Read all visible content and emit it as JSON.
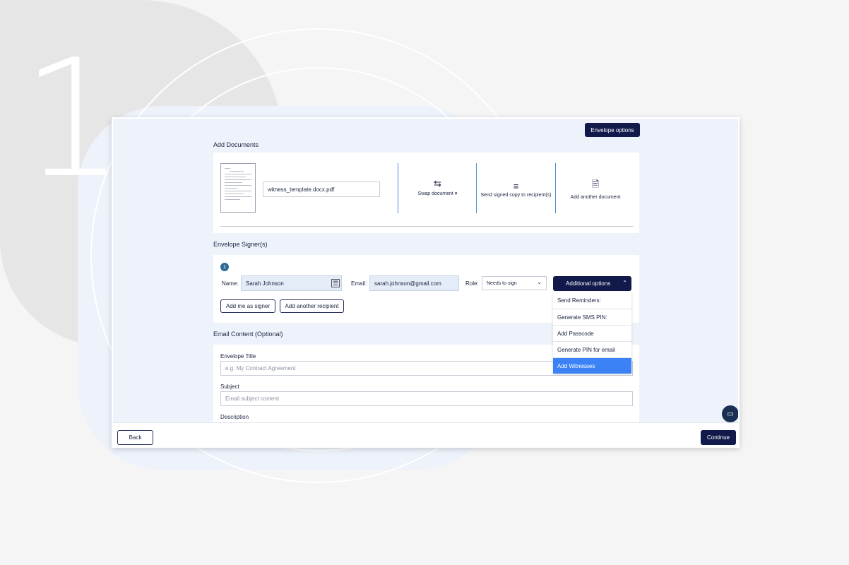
{
  "step_number": "1",
  "header": {
    "envelope_options_label": "Envelope options"
  },
  "documents": {
    "section_title": "Add Documents",
    "filename": "witness_template.docx.pdf",
    "actions": [
      {
        "label": "Swap document ▾",
        "icon": "swap-arrows-icon"
      },
      {
        "label": "Send signed copy to recipient(s)",
        "icon": "text-lines-icon"
      },
      {
        "label": "Add another document",
        "icon": "add-document-icon"
      }
    ]
  },
  "signers": {
    "section_title": "Envelope Signer(s)",
    "signer_number": "1",
    "name_label": "Name:",
    "name_value": "Sarah Johnson",
    "email_label": "Email:",
    "email_value": "sarah.johnson@gmail.com",
    "role_label": "Role:",
    "role_value": "Needs to sign",
    "additional_options_label": "Additional options",
    "add_me_label": "Add me as signer",
    "add_recipient_label": "Add another recipient",
    "options_menu": [
      "Send Reminders:",
      "Generate SMS PIN:",
      "Add Passcode",
      "Generate PIN for email",
      "Add Witnesses"
    ]
  },
  "email_content": {
    "section_title": "Email Content (Optional)",
    "envelope_title_label": "Envelope Title",
    "envelope_title_placeholder": "e.g. My Contract Agreement",
    "subject_label": "Subject",
    "subject_placeholder": "Email subject content",
    "description_label": "Description"
  },
  "footer": {
    "back_label": "Back",
    "continue_label": "Continue"
  },
  "colors": {
    "accent_dark": "#111a4a",
    "highlight": "#3b82f6",
    "separator": "#4f8fd6"
  }
}
